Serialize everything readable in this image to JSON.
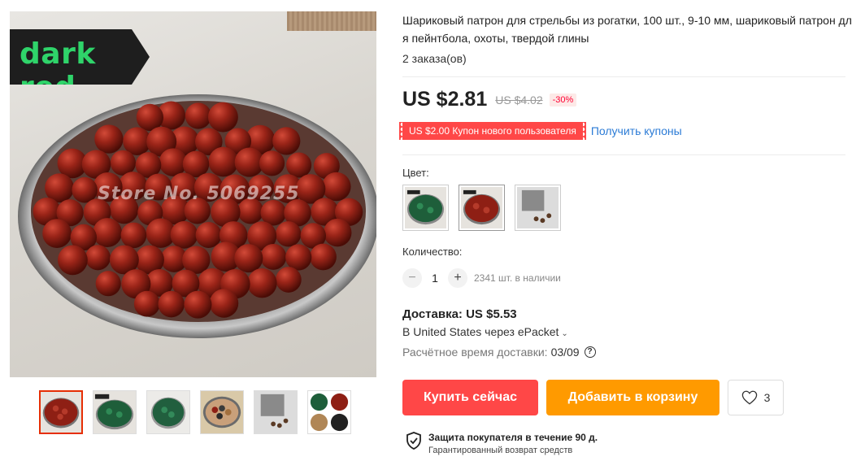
{
  "gallery": {
    "overlay_label": "dark red",
    "watermark": "Store No. 5069255",
    "thumbnails": [
      {
        "icon": "dark-red-balls-thumbnail"
      },
      {
        "icon": "green-balls-label-thumbnail"
      },
      {
        "icon": "green-balls-plate-thumbnail"
      },
      {
        "icon": "mixed-balls-thumbnail"
      },
      {
        "icon": "steel-balls-thumbnail"
      },
      {
        "icon": "color-grid-thumbnail"
      }
    ]
  },
  "product": {
    "title": "Шариковый патрон для стрельбы из рогатки, 100 шт., 9-10 мм, шариковый патрон для пейнтбола, охоты, твердой глины",
    "orders": "2 заказа(ов)",
    "price": "US $2.81",
    "old_price": "US $4.02",
    "discount": "-30%",
    "coupon": "US $2.00 Купон нового пользователя",
    "coupon_link": "Получить купоны"
  },
  "options": {
    "color_label": "Цвет:",
    "colors": [
      {
        "icon": "green-color-swatch"
      },
      {
        "icon": "dark-red-color-swatch"
      },
      {
        "icon": "steel-color-swatch"
      }
    ],
    "quantity_label": "Количество:",
    "quantity": "1",
    "minus": "−",
    "plus": "+",
    "stock": "2341 шт. в наличии"
  },
  "shipping": {
    "title": "Доставка: US $5.53",
    "via": "В United States через ePacket",
    "delivery_label": "Расчётное время доставки:",
    "delivery_date": "03/09",
    "help_icon": "?"
  },
  "actions": {
    "buy_now": "Купить сейчас",
    "add_to_cart": "Добавить в корзину",
    "wishlist_count": "3"
  },
  "protection": {
    "title": "Защита покупателя в течение 90 д.",
    "subtitle": "Гарантированный возврат средств"
  },
  "colors": {
    "accent_red": "#ff4747",
    "accent_orange": "#ff9a00",
    "link_blue": "#2b7bd6",
    "ball_red": "#8e1f14",
    "label_green": "#2fd46a"
  }
}
